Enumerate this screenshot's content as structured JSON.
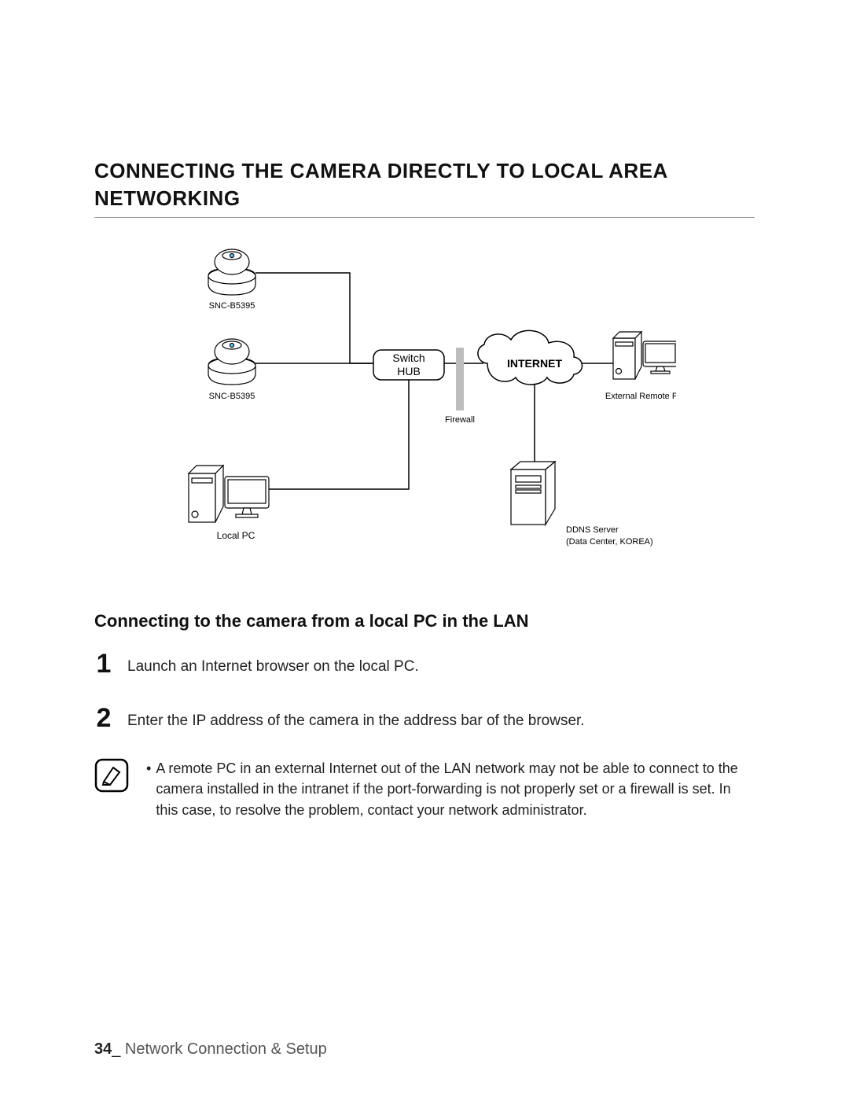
{
  "heading": "CONNECTING THE CAMERA DIRECTLY TO LOCAL AREA NETWORKING",
  "diagram": {
    "camera1_label": "SNC-B5395",
    "camera2_label": "SNC-B5395",
    "switch_label_line1": "Switch",
    "switch_label_line2": "HUB",
    "internet_label": "INTERNET",
    "firewall_label": "Firewall",
    "local_pc_label": "Local PC",
    "remote_pc_label": "External Remote PC",
    "ddns_label_line1": "DDNS Server",
    "ddns_label_line2": "(Data Center, KOREA)"
  },
  "subheading": "Connecting to the camera from a local PC in the LAN",
  "steps": [
    {
      "num": "1",
      "text": "Launch an Internet browser on the local PC."
    },
    {
      "num": "2",
      "text": "Enter the IP address of the camera in the address bar of the browser."
    }
  ],
  "note": {
    "bullet": "•",
    "text": "A remote PC in an external Internet out of the LAN network may not be able to connect to the camera installed in the intranet if the port-forwarding is not properly set or a firewall is set. In this case, to resolve the problem, contact your network administrator."
  },
  "footer": {
    "page_number": "34",
    "separator": "_",
    "section": " Network Connection & Setup"
  }
}
